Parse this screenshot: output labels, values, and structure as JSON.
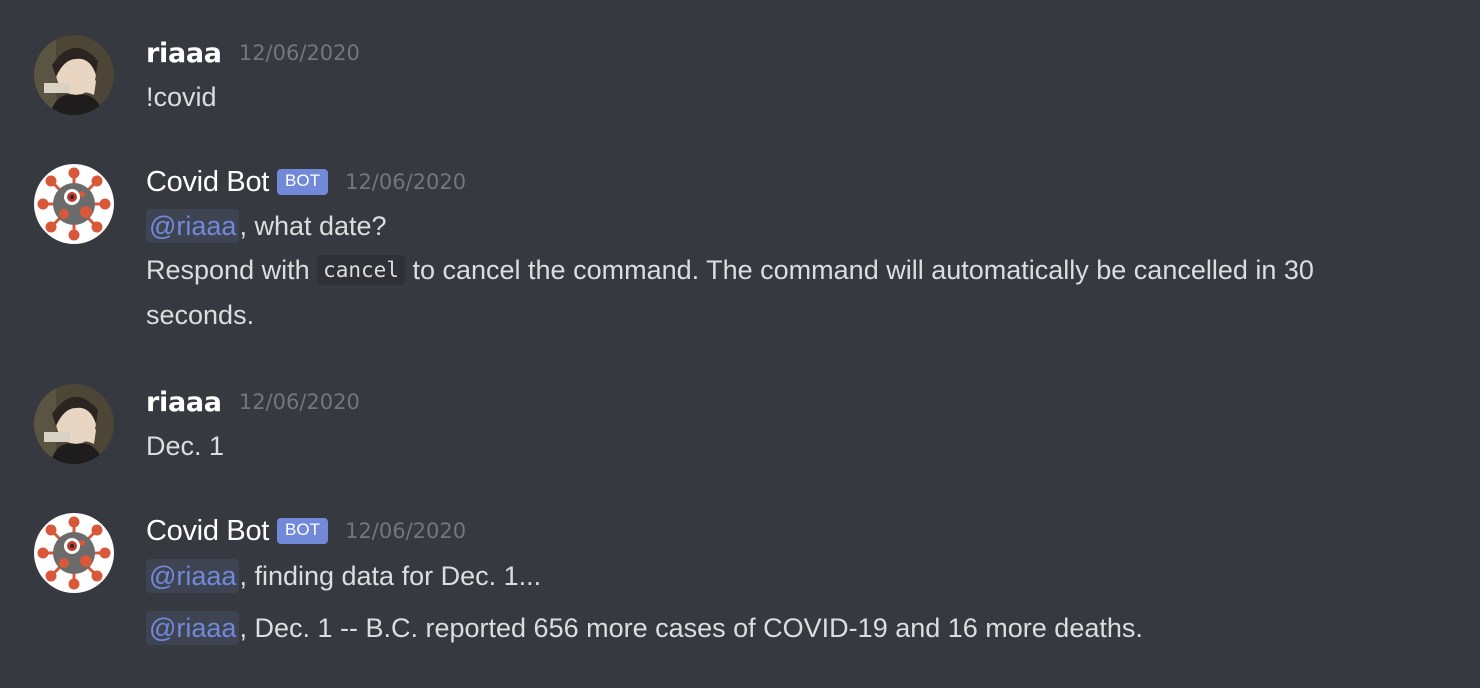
{
  "messages": [
    {
      "author": "riaaa",
      "timestamp": "12/06/2020",
      "text": "!covid"
    },
    {
      "author": "Covid Bot",
      "bot_tag": "BOT",
      "timestamp": "12/06/2020",
      "mention": "@riaaa",
      "line1_rest": ", what date?",
      "line2_before_code": "Respond with ",
      "line2_code": "cancel",
      "line2_after_code": " to cancel the command. The command will automatically be cancelled in 30",
      "line3": "seconds."
    },
    {
      "author": "riaaa",
      "timestamp": "12/06/2020",
      "text": "Dec. 1"
    },
    {
      "author": "Covid Bot",
      "bot_tag": "BOT",
      "timestamp": "12/06/2020",
      "mention": "@riaaa",
      "line1_rest": ", finding data for Dec. 1...",
      "mention2": "@riaaa",
      "line2_rest": ", Dec. 1 -- B.C. reported 656 more cases of COVID-19 and 16 more deaths."
    }
  ],
  "colors": {
    "background": "#36393f",
    "username": "#ffffff",
    "text": "#dcddde",
    "timestamp": "#72767d",
    "bot_tag": "#7289da",
    "mention": "#7289da",
    "mention_bg": "#3e4451",
    "code_bg": "#2f3136"
  },
  "icons": {
    "user_avatar": "user-avatar",
    "bot_avatar": "covid-virus-icon"
  }
}
